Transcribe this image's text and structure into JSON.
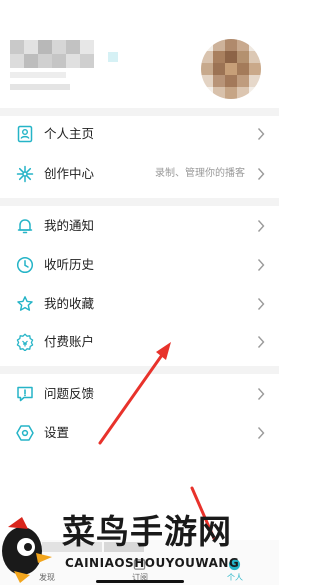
{
  "menu": {
    "items": [
      {
        "id": "profile",
        "label": "个人主页",
        "hint": "",
        "icon": "user-card-icon"
      },
      {
        "id": "creator",
        "label": "创作中心",
        "hint": "录制、管理你的播客",
        "icon": "sparkle-icon"
      },
      {
        "id": "notifications",
        "label": "我的通知",
        "hint": "",
        "icon": "bell-icon"
      },
      {
        "id": "history",
        "label": "收听历史",
        "hint": "",
        "icon": "clock-icon"
      },
      {
        "id": "favorites",
        "label": "我的收藏",
        "hint": "",
        "icon": "star-icon"
      },
      {
        "id": "paid-account",
        "label": "付费账户",
        "hint": "",
        "icon": "badge-icon"
      },
      {
        "id": "feedback",
        "label": "问题反馈",
        "hint": "",
        "icon": "feedback-icon"
      },
      {
        "id": "settings",
        "label": "设置",
        "hint": "",
        "icon": "hexagon-settings-icon"
      }
    ]
  },
  "tabbar": {
    "tabs": [
      {
        "id": "discover",
        "label": "发现",
        "active": false
      },
      {
        "id": "subscriptions",
        "label": "订阅",
        "active": false
      },
      {
        "id": "me",
        "label": "个人",
        "active": true
      }
    ]
  },
  "watermark": {
    "main": "菜鸟手游网",
    "sub": "CAINIAOSHOUYOUWANG"
  },
  "colors": {
    "accent": "#25b4c7",
    "annotation_arrow": "#e8322b",
    "divider": "#f3f3f3",
    "text": "#222222",
    "hint": "#9a9a9a"
  }
}
